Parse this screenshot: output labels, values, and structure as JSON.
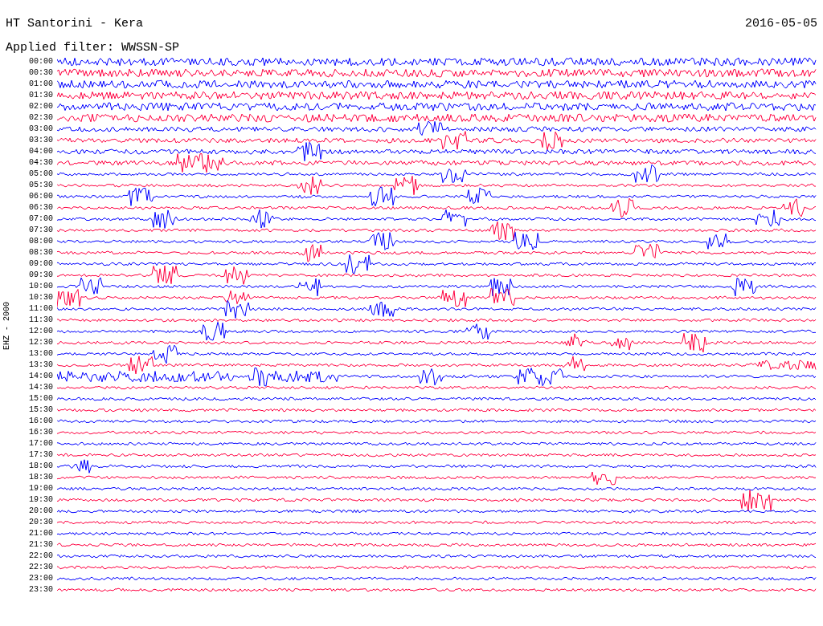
{
  "title": "HT Santorini - Kera",
  "date": "2016-05-05",
  "filter": "Applied filter: WWSSN-SP",
  "channel_label": "EHZ - 2000",
  "traces": [
    {
      "time": "00:00",
      "color": "#0000ff"
    },
    {
      "time": "00:30",
      "color": "#ff0040"
    },
    {
      "time": "01:00",
      "color": "#0000ff"
    },
    {
      "time": "01:30",
      "color": "#ff0040"
    },
    {
      "time": "02:00",
      "color": "#0000ff"
    },
    {
      "time": "02:30",
      "color": "#ff0040"
    },
    {
      "time": "03:00",
      "color": "#0000ff"
    },
    {
      "time": "03:30",
      "color": "#ff0040"
    },
    {
      "time": "04:00",
      "color": "#0000ff"
    },
    {
      "time": "04:30",
      "color": "#ff0040"
    },
    {
      "time": "05:00",
      "color": "#0000ff"
    },
    {
      "time": "05:30",
      "color": "#ff0040"
    },
    {
      "time": "06:00",
      "color": "#0000ff"
    },
    {
      "time": "06:30",
      "color": "#ff0040"
    },
    {
      "time": "07:00",
      "color": "#0000ff"
    },
    {
      "time": "07:30",
      "color": "#ff0040"
    },
    {
      "time": "08:00",
      "color": "#0000ff"
    },
    {
      "time": "08:30",
      "color": "#ff0040"
    },
    {
      "time": "09:00",
      "color": "#0000ff"
    },
    {
      "time": "09:30",
      "color": "#ff0040"
    },
    {
      "time": "10:00",
      "color": "#0000ff"
    },
    {
      "time": "10:30",
      "color": "#ff0040"
    },
    {
      "time": "11:00",
      "color": "#0000ff"
    },
    {
      "time": "11:30",
      "color": "#ff0040"
    },
    {
      "time": "12:00",
      "color": "#0000ff"
    },
    {
      "time": "12:30",
      "color": "#ff0040"
    },
    {
      "time": "13:00",
      "color": "#0000ff"
    },
    {
      "time": "13:30",
      "color": "#ff0040"
    },
    {
      "time": "14:00",
      "color": "#0000ff"
    },
    {
      "time": "14:30",
      "color": "#ff0040"
    },
    {
      "time": "15:00",
      "color": "#0000ff"
    },
    {
      "time": "15:30",
      "color": "#ff0040"
    },
    {
      "time": "16:00",
      "color": "#0000ff"
    },
    {
      "time": "16:30",
      "color": "#ff0040"
    },
    {
      "time": "17:00",
      "color": "#0000ff"
    },
    {
      "time": "17:30",
      "color": "#ff0040"
    },
    {
      "time": "18:00",
      "color": "#0000ff"
    },
    {
      "time": "18:30",
      "color": "#ff0040"
    },
    {
      "time": "19:00",
      "color": "#0000ff"
    },
    {
      "time": "19:30",
      "color": "#ff0040"
    },
    {
      "time": "20:00",
      "color": "#0000ff"
    },
    {
      "time": "20:30",
      "color": "#ff0040"
    },
    {
      "time": "21:00",
      "color": "#0000ff"
    },
    {
      "time": "21:30",
      "color": "#ff0040"
    },
    {
      "time": "22:00",
      "color": "#0000ff"
    },
    {
      "time": "22:30",
      "color": "#ff0040"
    },
    {
      "time": "23:00",
      "color": "#0000ff"
    },
    {
      "time": "23:30",
      "color": "#ff0040"
    }
  ]
}
